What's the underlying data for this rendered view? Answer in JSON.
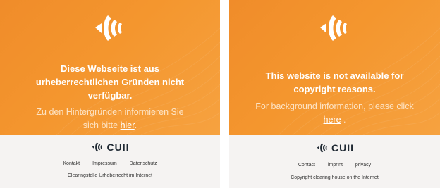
{
  "de": {
    "headline_line1": "Diese Webseite ist aus",
    "headline_line2": "urheberrechtlichen Gründen nicht",
    "headline_line3": "verfügbar.",
    "sub_line1": "Zu den Hintergründen informieren Sie",
    "sub_prefix": "sich bitte ",
    "sub_link": "hier",
    "sub_suffix": ".",
    "brand": "CUII",
    "links": [
      "Kontakt",
      "Impressum",
      "Datenschutz"
    ],
    "tagline": "Clearingstelle Urheberrecht im Internet"
  },
  "en": {
    "headline_line1": "This website is not available for",
    "headline_line2": "copyright reasons.",
    "sub_line1": "For background information, please click",
    "sub_link": "here",
    "sub_suffix": " .",
    "brand": "CUII",
    "links": [
      "Contact",
      "imprint",
      "privacy"
    ],
    "tagline": "Copyright clearing house on the Internet"
  },
  "colors": {
    "orange": "#f4962e",
    "footer_bg": "#f5f3f2",
    "brand_dark": "#1f2933"
  },
  "icons": [
    "cuii-logo-icon"
  ]
}
